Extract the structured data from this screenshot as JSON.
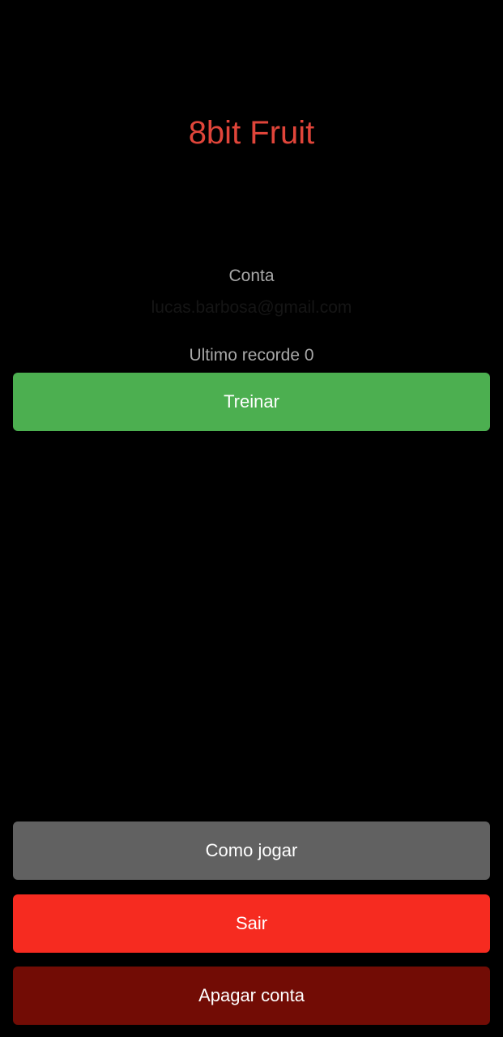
{
  "app": {
    "title": "8bit Fruit",
    "title_color": "#e0453a"
  },
  "account": {
    "label": "Conta",
    "email": "lucas.barbosa@gmail.com"
  },
  "record": {
    "label": "Ultimo recorde 0"
  },
  "buttons": {
    "train": {
      "label": "Treinar",
      "color": "#4caf50"
    },
    "how_to_play": {
      "label": "Como jogar",
      "color": "#616161"
    },
    "exit": {
      "label": "Sair",
      "color": "#f62b20"
    },
    "delete_account": {
      "label": "Apagar conta",
      "color": "#720c05"
    }
  }
}
